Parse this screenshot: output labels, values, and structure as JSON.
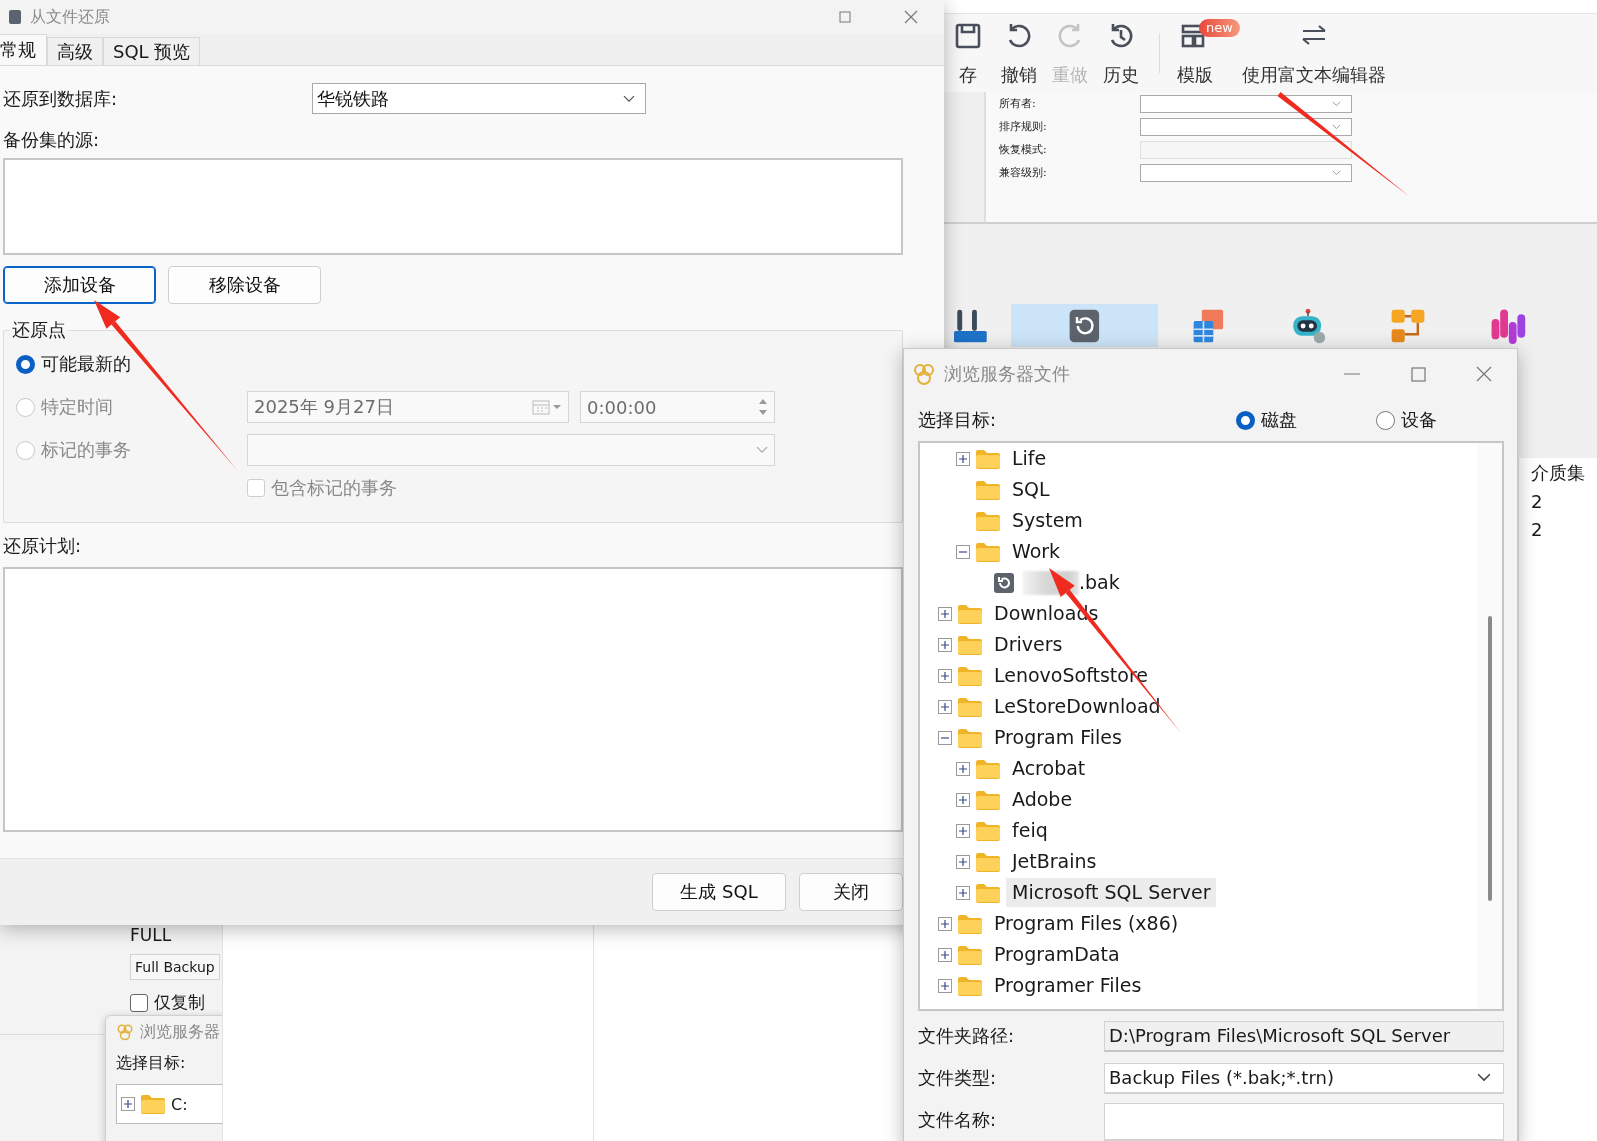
{
  "restore_dialog": {
    "title": "从文件还原",
    "tabs": [
      {
        "label": "常规",
        "selected": true
      },
      {
        "label": "高级",
        "selected": false
      },
      {
        "label": "SQL 预览",
        "selected": false
      }
    ],
    "database": {
      "label": "还原到数据库:",
      "value": "华锐铁路"
    },
    "source_label": "备份集的源:",
    "device_buttons": [
      {
        "label": "添加设备",
        "focused": true
      },
      {
        "label": "移除设备",
        "focused": false
      }
    ],
    "restore_point": {
      "label": "还原点",
      "options": [
        {
          "label": "可能最新的",
          "selected": true,
          "disabled": false
        },
        {
          "label": "特定时间",
          "selected": false,
          "disabled": true
        },
        {
          "label": "标记的事务",
          "selected": false,
          "disabled": true
        }
      ],
      "date": "2025年  9月27日",
      "time": "0:00:00",
      "include_marked": {
        "label": "包含标记的事务",
        "checked": false,
        "disabled": true
      }
    },
    "plan_label": "还原计划:",
    "footer_buttons": [
      {
        "label": "生成 SQL"
      },
      {
        "label": "关闭"
      }
    ]
  },
  "background_app": {
    "toolbar_groups": [
      {
        "items": [
          {
            "kind": "save",
            "label": "存",
            "disabled": false
          },
          {
            "kind": "undo",
            "label": "撤销",
            "disabled": false
          },
          {
            "kind": "redo",
            "label": "重做",
            "disabled": true
          },
          {
            "kind": "history",
            "label": "历史",
            "disabled": false
          }
        ]
      },
      {
        "items": [
          {
            "kind": "template",
            "label": "模版",
            "disabled": false,
            "badge": "new"
          },
          {
            "kind": "editor",
            "label": "使用富文本编辑器",
            "disabled": false
          }
        ]
      }
    ],
    "properties": [
      {
        "label": "所有者:",
        "disabled": false
      },
      {
        "label": "排序规则:",
        "disabled": false
      },
      {
        "label": "恢复模式:",
        "disabled": true
      },
      {
        "label": "兼容级别:",
        "disabled": false
      }
    ],
    "tool_icons": [
      {
        "kind": "tools",
        "selected": false
      },
      {
        "kind": "restore",
        "selected": true
      },
      {
        "kind": "table",
        "selected": false
      },
      {
        "kind": "robot",
        "selected": false
      },
      {
        "kind": "hierarchy",
        "selected": false
      },
      {
        "kind": "chart",
        "selected": false
      }
    ],
    "media_column": {
      "header": "介质集",
      "rows": [
        "2",
        "2"
      ]
    },
    "backup_panel": {
      "type": "FULL",
      "name": "Full Backup",
      "copy_only": {
        "label": "仅复制",
        "checked": false
      },
      "mini_browser": {
        "title": "浏览服务器",
        "target_label": "选择目标:",
        "items": [
          {
            "label": "C:",
            "expanded": false
          }
        ]
      }
    }
  },
  "browse_dialog": {
    "title": "浏览服务器文件",
    "target_label": "选择目标:",
    "targets": [
      {
        "label": "磁盘",
        "selected": true
      },
      {
        "label": "设备",
        "selected": false
      }
    ],
    "tree": [
      {
        "children": [
          {
            "kind": "folder",
            "label": "Life",
            "expanded": false,
            "selected": false
          },
          {
            "kind": "folder",
            "label": "SQL",
            "selected": false
          },
          {
            "kind": "folder",
            "label": "System",
            "selected": false
          },
          {
            "kind": "folder",
            "label": "Work",
            "expanded": true,
            "selected": false,
            "children": [
              {
                "kind": "file",
                "label": ".bak",
                "redacted": true,
                "selected": false
              }
            ]
          }
        ]
      },
      {
        "kind": "folder",
        "label": "Downloads",
        "expanded": false,
        "selected": false
      },
      {
        "kind": "folder",
        "label": "Drivers",
        "expanded": false,
        "selected": false
      },
      {
        "kind": "folder",
        "label": "LenovoSoftstore",
        "expanded": false,
        "selected": false
      },
      {
        "kind": "folder",
        "label": "LeStoreDownload",
        "expanded": false,
        "selected": false
      },
      {
        "kind": "folder",
        "label": "Program Files",
        "expanded": true,
        "selected": false,
        "children": [
          {
            "kind": "folder",
            "label": "Acrobat",
            "expanded": false,
            "selected": false
          },
          {
            "kind": "folder",
            "label": "Adobe",
            "expanded": false,
            "selected": false
          },
          {
            "kind": "folder",
            "label": "feiq",
            "expanded": false,
            "selected": false
          },
          {
            "kind": "folder",
            "label": "JetBrains",
            "expanded": false,
            "selected": false
          },
          {
            "kind": "folder",
            "label": "Microsoft SQL Server",
            "expanded": false,
            "selected": true
          }
        ]
      },
      {
        "kind": "folder",
        "label": "Program Files (x86)",
        "expanded": false,
        "selected": false
      },
      {
        "kind": "folder",
        "label": "ProgramData",
        "expanded": false,
        "selected": false
      },
      {
        "kind": "folder",
        "label": "Programer Files",
        "expanded": false,
        "selected": false
      }
    ],
    "fields": [
      {
        "kind": "readonly",
        "label": "文件夹路径:",
        "value": "D:\\Program Files\\Microsoft SQL Server"
      },
      {
        "kind": "select",
        "label": "文件类型:",
        "value": "Backup Files (*.bak;*.trn)"
      },
      {
        "kind": "input",
        "label": "文件名称:"
      }
    ]
  }
}
